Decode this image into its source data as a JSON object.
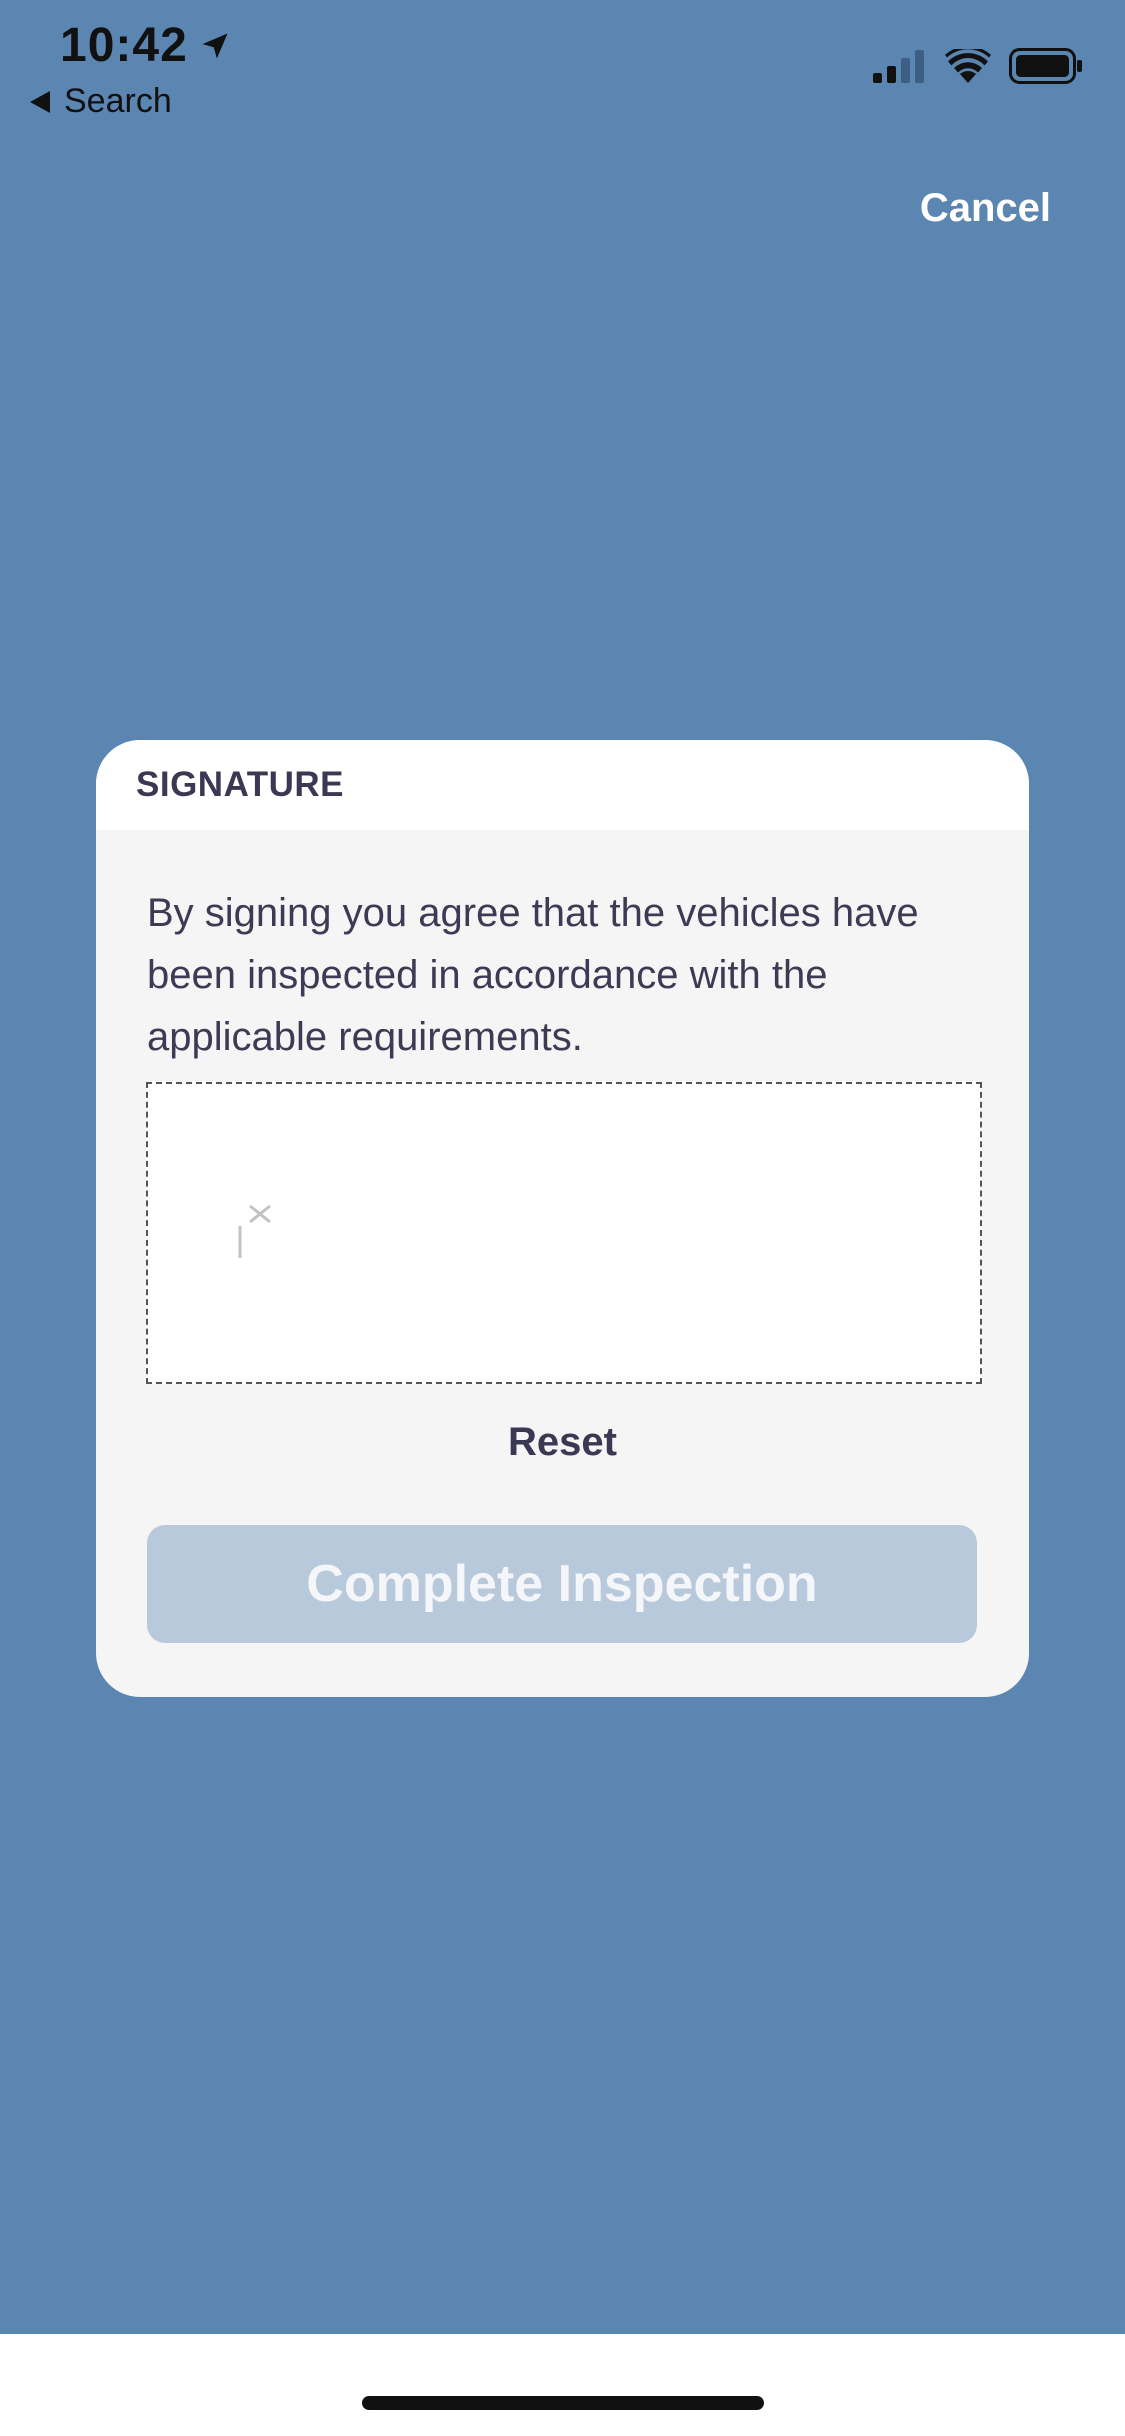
{
  "status_bar": {
    "time": "10:42",
    "back_label": "Search"
  },
  "nav": {
    "cancel_label": "Cancel"
  },
  "signature_modal": {
    "title": "SIGNATURE",
    "agreement_text": "By signing you agree that the vehicles have been inspected in accordance with the applicable requirements.",
    "reset_label": "Reset",
    "complete_label": "Complete Inspection"
  },
  "colors": {
    "background": "#5b86b1",
    "modal_body": "#f5f5f6",
    "text_dark": "#3a3852",
    "button_disabled": "#b8c9db"
  },
  "icons": [
    "location-arrow-icon",
    "cellular-signal-icon",
    "wifi-icon",
    "battery-icon",
    "back-triangle-icon"
  ]
}
